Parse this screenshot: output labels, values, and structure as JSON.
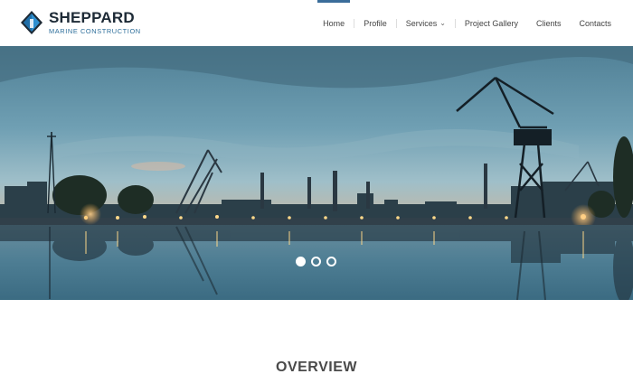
{
  "brand": {
    "name": "SHEPPARD",
    "subtitle": "MARINE CONSTRUCTION"
  },
  "nav": {
    "items": [
      {
        "label": "Home",
        "active": true
      },
      {
        "label": "Profile"
      },
      {
        "label": "Services",
        "dropdown": true
      },
      {
        "label": "Project Gallery"
      },
      {
        "label": "Clients"
      },
      {
        "label": "Contacts"
      }
    ]
  },
  "hero": {
    "slides": 3,
    "active_slide": 1
  },
  "overview": {
    "title": "OVERVIEW"
  },
  "colors": {
    "accent": "#3a6d9a",
    "sky_top": "#5a8aa0",
    "water": "#3f6f86"
  }
}
